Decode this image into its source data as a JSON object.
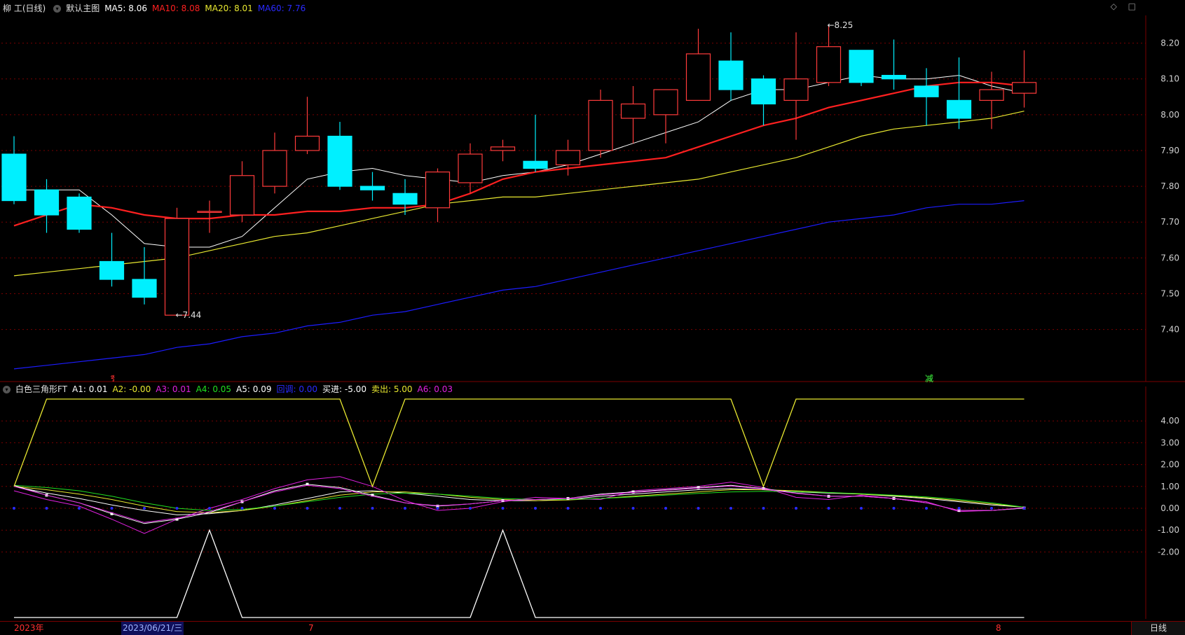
{
  "main_header": {
    "stock": "柳 工(日线)",
    "chart_name": "默认主图",
    "ma5": "MA5: 8.06",
    "ma10": "MA10: 8.08",
    "ma20": "MA20: 8.01",
    "ma60": "MA60: 7.76"
  },
  "sub_header": {
    "indicator_name": "白色三角形FT",
    "a1": "A1: 0.01",
    "a2": "A2: -0.00",
    "a3": "A3: 0.01",
    "a4": "A4: 0.05",
    "a5": "A5: 0.09",
    "ab": "回调: 0.00",
    "buy": "买进: -5.00",
    "sell": "卖出: 5.00",
    "a6": "A6: 0.03"
  },
  "top_icons": [
    "◇",
    "□"
  ],
  "markers": {
    "red_small": "รี",
    "green_small": "减"
  },
  "footer": {
    "year": "2023年",
    "selected_date": "2023/06/21/三",
    "month_7": "7",
    "month_8": "8",
    "period_button": "日线"
  },
  "colors": {
    "up": "#ff3b3b",
    "down": "#00f0ff",
    "ma5": "#ffffff",
    "ma10": "#ff2020",
    "ma20": "#e8e830",
    "ma60": "#1c1cff",
    "grid": "#7a0000",
    "axis_label": "#d0d0d0",
    "a1": "#ffffff",
    "a2": "#e8e830",
    "a3": "#e020e0",
    "a4": "#20e020",
    "a5": "#ffffff",
    "ab": "#2a2aff",
    "buy": "#ffffff",
    "sell": "#e8e830",
    "a6": "#e020e0"
  },
  "chart_data": [
    {
      "type": "candlestick",
      "title": "默认主图",
      "ylim": [
        7.28,
        8.25
      ],
      "yticks": [
        "8.20",
        "8.10",
        "8.00",
        "7.90",
        "7.80",
        "7.70",
        "7.60",
        "7.50",
        "7.40"
      ],
      "annotations": [
        {
          "label": "←7.44",
          "value": 7.44
        },
        {
          "label": "←8.25",
          "value": 8.25
        }
      ],
      "candles": [
        {
          "o": 7.89,
          "h": 7.94,
          "l": 7.75,
          "c": 7.76
        },
        {
          "o": 7.79,
          "h": 7.82,
          "l": 7.67,
          "c": 7.72
        },
        {
          "o": 7.77,
          "h": 7.78,
          "l": 7.67,
          "c": 7.68
        },
        {
          "o": 7.59,
          "h": 7.67,
          "l": 7.52,
          "c": 7.54
        },
        {
          "o": 7.54,
          "h": 7.63,
          "l": 7.47,
          "c": 7.49
        },
        {
          "o": 7.44,
          "h": 7.74,
          "l": 7.44,
          "c": 7.71
        },
        {
          "o": 7.73,
          "h": 7.76,
          "l": 7.67,
          "c": 7.73
        },
        {
          "o": 7.72,
          "h": 7.87,
          "l": 7.7,
          "c": 7.83
        },
        {
          "o": 7.8,
          "h": 7.95,
          "l": 7.78,
          "c": 7.9
        },
        {
          "o": 7.9,
          "h": 8.05,
          "l": 7.89,
          "c": 7.94
        },
        {
          "o": 7.94,
          "h": 7.98,
          "l": 7.79,
          "c": 7.8
        },
        {
          "o": 7.8,
          "h": 7.84,
          "l": 7.76,
          "c": 7.79
        },
        {
          "o": 7.78,
          "h": 7.82,
          "l": 7.72,
          "c": 7.75
        },
        {
          "o": 7.74,
          "h": 7.85,
          "l": 7.7,
          "c": 7.84
        },
        {
          "o": 7.81,
          "h": 7.92,
          "l": 7.78,
          "c": 7.89
        },
        {
          "o": 7.9,
          "h": 7.93,
          "l": 7.87,
          "c": 7.91
        },
        {
          "o": 7.87,
          "h": 8.0,
          "l": 7.84,
          "c": 7.85
        },
        {
          "o": 7.86,
          "h": 7.93,
          "l": 7.83,
          "c": 7.9
        },
        {
          "o": 7.9,
          "h": 8.07,
          "l": 7.88,
          "c": 8.04
        },
        {
          "o": 7.99,
          "h": 8.08,
          "l": 7.92,
          "c": 8.03
        },
        {
          "o": 8.0,
          "h": 8.07,
          "l": 7.92,
          "c": 8.07
        },
        {
          "o": 8.04,
          "h": 8.24,
          "l": 8.04,
          "c": 8.17
        },
        {
          "o": 8.15,
          "h": 8.23,
          "l": 8.04,
          "c": 8.07
        },
        {
          "o": 8.1,
          "h": 8.11,
          "l": 7.97,
          "c": 8.03
        },
        {
          "o": 8.04,
          "h": 8.23,
          "l": 7.93,
          "c": 8.1
        },
        {
          "o": 8.09,
          "h": 8.25,
          "l": 8.08,
          "c": 8.19
        },
        {
          "o": 8.18,
          "h": 8.18,
          "l": 8.08,
          "c": 8.09
        },
        {
          "o": 8.11,
          "h": 8.21,
          "l": 8.07,
          "c": 8.1
        },
        {
          "o": 8.08,
          "h": 8.13,
          "l": 7.97,
          "c": 8.05
        },
        {
          "o": 8.04,
          "h": 8.16,
          "l": 7.96,
          "c": 7.99
        },
        {
          "o": 8.04,
          "h": 8.12,
          "l": 7.96,
          "c": 8.07
        },
        {
          "o": 8.06,
          "h": 8.18,
          "l": 8.02,
          "c": 8.09
        }
      ],
      "series": [
        {
          "name": "MA5",
          "values": [
            7.79,
            7.79,
            7.79,
            7.72,
            7.64,
            7.63,
            7.63,
            7.66,
            7.74,
            7.82,
            7.84,
            7.85,
            7.83,
            7.82,
            7.81,
            7.83,
            7.84,
            7.86,
            7.89,
            7.92,
            7.95,
            7.98,
            8.04,
            8.07,
            8.07,
            8.09,
            8.11,
            8.1,
            8.1,
            8.11,
            8.08,
            8.06
          ]
        },
        {
          "name": "MA10",
          "values": [
            7.69,
            7.72,
            7.75,
            7.74,
            7.72,
            7.71,
            7.71,
            7.72,
            7.72,
            7.73,
            7.73,
            7.74,
            7.74,
            7.75,
            7.78,
            7.82,
            7.84,
            7.85,
            7.86,
            7.87,
            7.88,
            7.91,
            7.94,
            7.97,
            7.99,
            8.02,
            8.04,
            8.06,
            8.08,
            8.09,
            8.09,
            8.08
          ]
        },
        {
          "name": "MA20",
          "values": [
            7.55,
            7.56,
            7.57,
            7.58,
            7.59,
            7.6,
            7.62,
            7.64,
            7.66,
            7.67,
            7.69,
            7.71,
            7.73,
            7.75,
            7.76,
            7.77,
            7.77,
            7.78,
            7.79,
            7.8,
            7.81,
            7.82,
            7.84,
            7.86,
            7.88,
            7.91,
            7.94,
            7.96,
            7.97,
            7.98,
            7.99,
            8.01
          ]
        },
        {
          "name": "MA60",
          "values": [
            7.29,
            7.3,
            7.31,
            7.32,
            7.33,
            7.35,
            7.36,
            7.38,
            7.39,
            7.41,
            7.42,
            7.44,
            7.45,
            7.47,
            7.49,
            7.51,
            7.52,
            7.54,
            7.56,
            7.58,
            7.6,
            7.62,
            7.64,
            7.66,
            7.68,
            7.7,
            7.71,
            7.72,
            7.74,
            7.75,
            7.75,
            7.76
          ]
        }
      ]
    },
    {
      "type": "line",
      "title": "白色三角形FT",
      "ylim": [
        -5.0,
        5.0
      ],
      "yticks": [
        "4.00",
        "3.00",
        "2.00",
        "1.00",
        "0.00",
        "-1.00",
        "-2.00"
      ],
      "series": [
        {
          "name": "A1",
          "values": [
            1.0,
            0.7,
            0.45,
            0.15,
            -0.1,
            -0.3,
            -0.25,
            -0.1,
            0.15,
            0.45,
            0.75,
            0.8,
            0.7,
            0.55,
            0.4,
            0.35,
            0.35,
            0.4,
            0.55,
            0.65,
            0.75,
            0.85,
            0.9,
            0.85,
            0.75,
            0.7,
            0.65,
            0.55,
            0.45,
            0.3,
            0.15,
            0.05
          ]
        },
        {
          "name": "A2",
          "values": [
            1.0,
            0.85,
            0.65,
            0.4,
            0.1,
            -0.15,
            -0.2,
            -0.1,
            0.1,
            0.35,
            0.6,
            0.75,
            0.75,
            0.65,
            0.5,
            0.4,
            0.35,
            0.38,
            0.45,
            0.55,
            0.65,
            0.75,
            0.85,
            0.85,
            0.8,
            0.72,
            0.65,
            0.58,
            0.48,
            0.35,
            0.2,
            0.05
          ]
        },
        {
          "name": "A3",
          "values": [
            0.8,
            0.4,
            0.1,
            -0.5,
            -1.15,
            -0.5,
            0.0,
            0.4,
            0.9,
            1.3,
            1.45,
            1.0,
            0.35,
            -0.1,
            0.0,
            0.3,
            0.5,
            0.45,
            0.4,
            0.8,
            0.9,
            1.0,
            1.2,
            0.95,
            0.5,
            0.4,
            0.6,
            0.45,
            0.3,
            -0.15,
            -0.1,
            0.01
          ]
        },
        {
          "name": "A4",
          "values": [
            1.05,
            0.95,
            0.8,
            0.55,
            0.25,
            0.0,
            -0.1,
            -0.05,
            0.1,
            0.3,
            0.5,
            0.65,
            0.7,
            0.65,
            0.55,
            0.45,
            0.4,
            0.4,
            0.45,
            0.52,
            0.6,
            0.68,
            0.75,
            0.78,
            0.76,
            0.72,
            0.67,
            0.6,
            0.52,
            0.4,
            0.25,
            0.05
          ]
        },
        {
          "name": "A5",
          "values": [
            1.05,
            0.6,
            0.25,
            -0.25,
            -0.7,
            -0.5,
            -0.2,
            0.3,
            0.8,
            1.1,
            0.95,
            0.6,
            0.25,
            0.1,
            0.2,
            0.35,
            0.4,
            0.45,
            0.65,
            0.75,
            0.85,
            0.95,
            1.05,
            0.9,
            0.7,
            0.55,
            0.55,
            0.45,
            0.25,
            -0.1,
            -0.1,
            0.01
          ]
        },
        {
          "name": "回调",
          "values": [
            0,
            0,
            0,
            0,
            0,
            0,
            0,
            0,
            0,
            0,
            0,
            0,
            0,
            0,
            0,
            0,
            0,
            0,
            0,
            0,
            0,
            0,
            0,
            0,
            0,
            0,
            0,
            0,
            0,
            0,
            0,
            0
          ]
        },
        {
          "name": "买进",
          "values": [
            -5,
            -5,
            -5,
            -5,
            -5,
            -5,
            -1,
            -5,
            -5,
            -5,
            -5,
            -5,
            -5,
            -5,
            -5,
            -1,
            -5,
            -5,
            -5,
            -5,
            -5,
            -5,
            -5,
            -5,
            -5,
            -5,
            -5,
            -5,
            -5,
            -5,
            -5,
            -5
          ]
        },
        {
          "name": "卖出",
          "values": [
            1,
            5,
            5,
            5,
            5,
            5,
            5,
            5,
            5,
            5,
            5,
            1,
            5,
            5,
            5,
            5,
            5,
            5,
            5,
            5,
            5,
            5,
            5,
            1,
            5,
            5,
            5,
            5,
            5,
            5,
            5,
            5
          ]
        },
        {
          "name": "A6",
          "values": [
            1.0,
            0.6,
            0.25,
            -0.2,
            -0.65,
            -0.45,
            -0.15,
            0.3,
            0.75,
            1.05,
            0.9,
            0.55,
            0.25,
            0.12,
            0.2,
            0.35,
            0.4,
            0.45,
            0.62,
            0.72,
            0.82,
            0.92,
            1.02,
            0.88,
            0.68,
            0.55,
            0.55,
            0.45,
            0.25,
            -0.1,
            -0.1,
            0.03
          ]
        }
      ]
    }
  ]
}
